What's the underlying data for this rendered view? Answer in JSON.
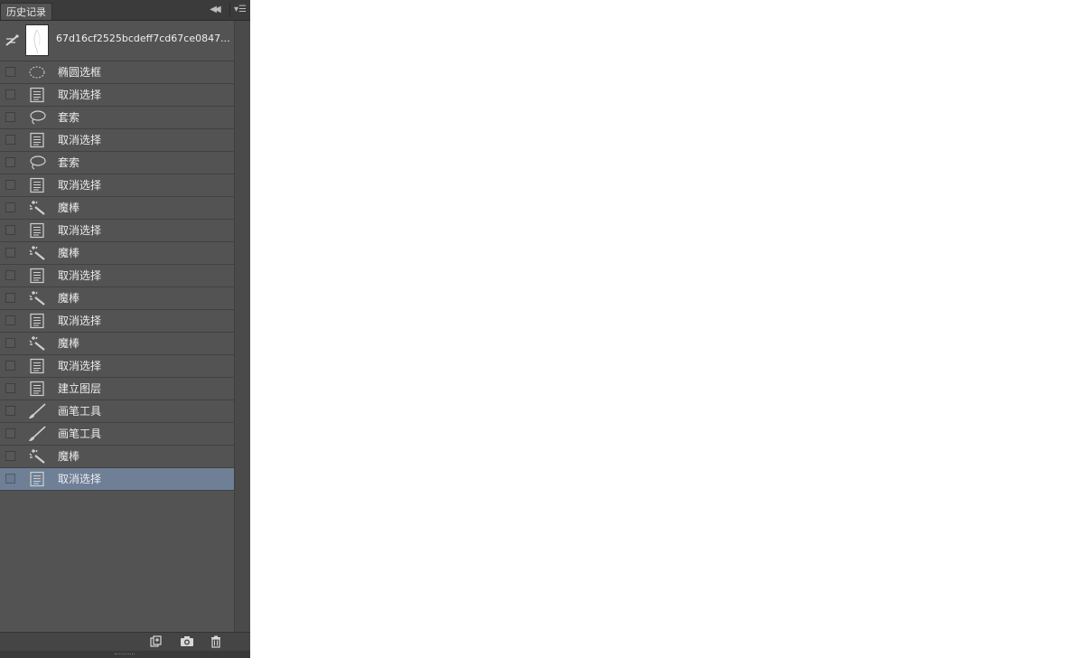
{
  "panel": {
    "tab_title": "历史记录",
    "collapse_icon": "double-chevron-left-icon",
    "menu_icon": "panel-menu-icon"
  },
  "snapshot": {
    "name": "67d16cf2525bcdeff7cd67ce0847..."
  },
  "history": [
    {
      "label": "椭圆选框",
      "icon": "ellipse-marquee-icon",
      "selected": false
    },
    {
      "label": "取消选择",
      "icon": "document-icon",
      "selected": false
    },
    {
      "label": "套索",
      "icon": "lasso-icon",
      "selected": false
    },
    {
      "label": "取消选择",
      "icon": "document-icon",
      "selected": false
    },
    {
      "label": "套索",
      "icon": "lasso-icon",
      "selected": false
    },
    {
      "label": "取消选择",
      "icon": "document-icon",
      "selected": false
    },
    {
      "label": "魔棒",
      "icon": "magic-wand-icon",
      "selected": false
    },
    {
      "label": "取消选择",
      "icon": "document-icon",
      "selected": false
    },
    {
      "label": "魔棒",
      "icon": "magic-wand-icon",
      "selected": false
    },
    {
      "label": "取消选择",
      "icon": "document-icon",
      "selected": false
    },
    {
      "label": "魔棒",
      "icon": "magic-wand-icon",
      "selected": false
    },
    {
      "label": "取消选择",
      "icon": "document-icon",
      "selected": false
    },
    {
      "label": "魔棒",
      "icon": "magic-wand-icon",
      "selected": false
    },
    {
      "label": "取消选择",
      "icon": "document-icon",
      "selected": false
    },
    {
      "label": "建立图层",
      "icon": "document-icon",
      "selected": false
    },
    {
      "label": "画笔工具",
      "icon": "brush-icon",
      "selected": false
    },
    {
      "label": "画笔工具",
      "icon": "brush-icon",
      "selected": false
    },
    {
      "label": "魔棒",
      "icon": "magic-wand-icon",
      "selected": false
    },
    {
      "label": "取消选择",
      "icon": "document-icon",
      "selected": true
    }
  ],
  "footer": {
    "buttons": [
      "new-document-from-state-icon",
      "camera-snapshot-icon",
      "trash-icon"
    ]
  },
  "colors": {
    "panel_bg": "#535353",
    "selected_row": "#6e7f96",
    "text": "#ececec"
  }
}
